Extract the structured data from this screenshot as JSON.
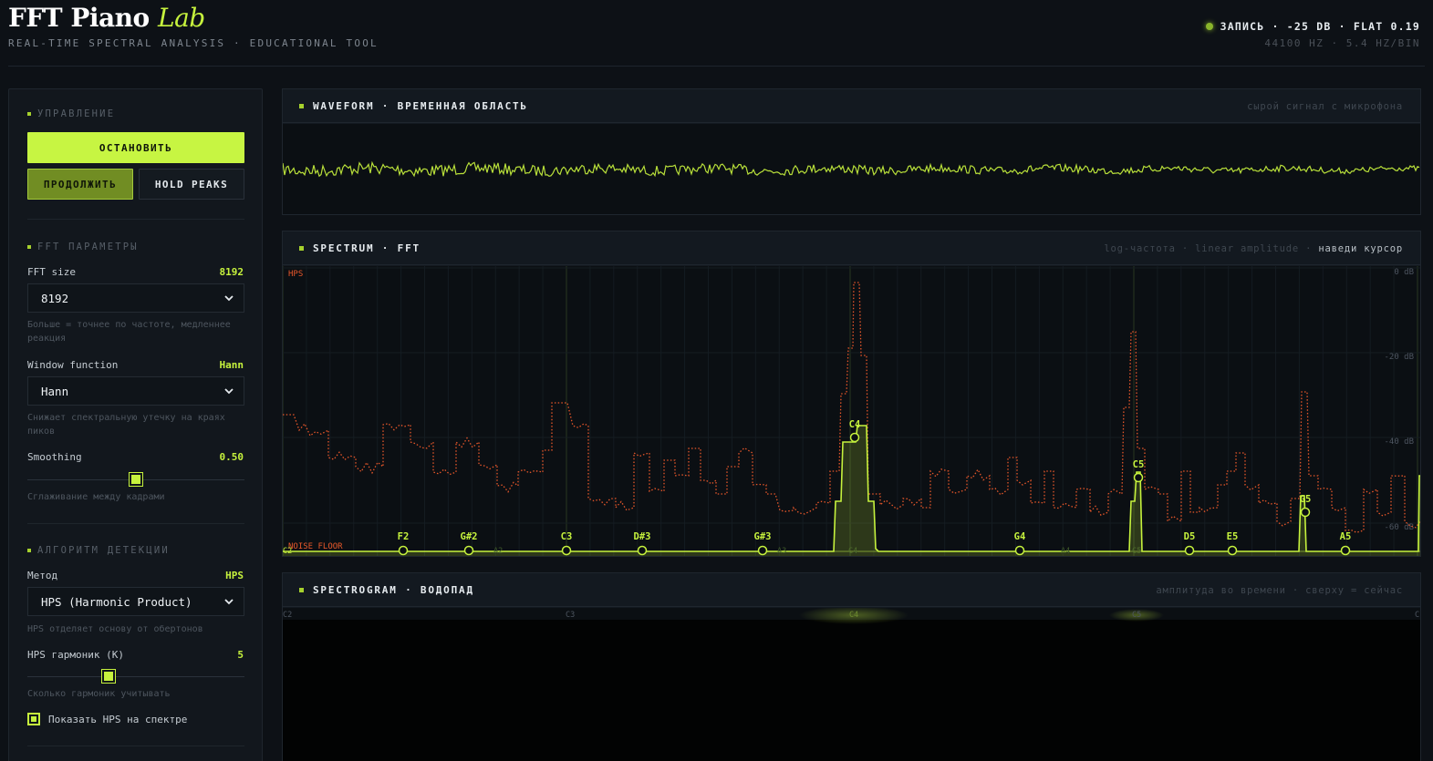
{
  "header": {
    "title_main": "FFT Piano",
    "title_accent": "Lab",
    "subtitle": "REAL-TIME SPECTRAL ANALYSIS · EDUCATIONAL TOOL",
    "status": "ЗАПИСЬ · -25 DB · FLAT 0.19",
    "status_sub": "44100 HZ · 5.4 HZ/BIN",
    "status_color": "#8ab52b"
  },
  "sidebar": {
    "control": {
      "title": "УПРАВЛЕНИЕ",
      "stop_label": "ОСТАНОВИТЬ",
      "resume_label": "ПРОДОЛЖИТЬ",
      "hold_label": "HOLD PEAKS"
    },
    "fft": {
      "title": "FFT ПАРАМЕТРЫ",
      "size_label": "FFT size",
      "size_value": "8192",
      "size_selected": "8192",
      "size_hint": "Больше = точнее по частоте, медленнее реакция",
      "window_label": "Window function",
      "window_value": "Hann",
      "window_selected": "Hann",
      "window_hint": "Снижает спектральную утечку на краях пиков",
      "smoothing_label": "Smoothing",
      "smoothing_value": "0.50",
      "smoothing_level": 0.5,
      "smoothing_hint": "Сглаживание между кадрами"
    },
    "detect": {
      "title": "АЛГОРИТМ ДЕТЕКЦИИ",
      "method_label": "Метод",
      "method_value": "HPS",
      "method_selected": "HPS (Harmonic Product)",
      "method_hint": "HPS отделяет основу от обертонов",
      "harmonics_label": "HPS гармоник (K)",
      "harmonics_value": "5",
      "harmonics_level": 5,
      "harmonics_hint": "Сколько гармоник учитывать",
      "show_hps_label": "Показать HPS на спектре",
      "show_hps_checked": true
    }
  },
  "waveform": {
    "title": "WAVEFORM · ВРЕМЕННАЯ ОБЛАСТЬ",
    "note": "сырой сигнал с микрофона",
    "color": "#b9e03a"
  },
  "spectrum": {
    "title": "SPECTRUM · FFT",
    "note_main": "log-частота · linear amplitude · ",
    "note_hint": "наведи курсор",
    "hps_label": "HPS",
    "noise_label": "NOISE FLOOR",
    "db_labels": [
      "0 dB",
      "-20 dB",
      "-40 dB",
      "-60 dB"
    ],
    "axis_notes": [
      "C2",
      "A2",
      "C3",
      "A3",
      "C4",
      "A4",
      "C5"
    ],
    "peaks": [
      "F2",
      "G#2",
      "C3",
      "D#3",
      "G#3",
      "C4",
      "G4",
      "C5",
      "D5",
      "E5",
      "G5",
      "A5"
    ],
    "colors": {
      "spectrum": "#c6f23d",
      "hps": "#e8572a"
    }
  },
  "spectrogram": {
    "title": "SPECTROGRAM · ВОДОПАД",
    "note": "амплитуда во времени · сверху = сейчас",
    "axis_notes": [
      "C2",
      "C3",
      "C4",
      "C5",
      "C"
    ]
  }
}
